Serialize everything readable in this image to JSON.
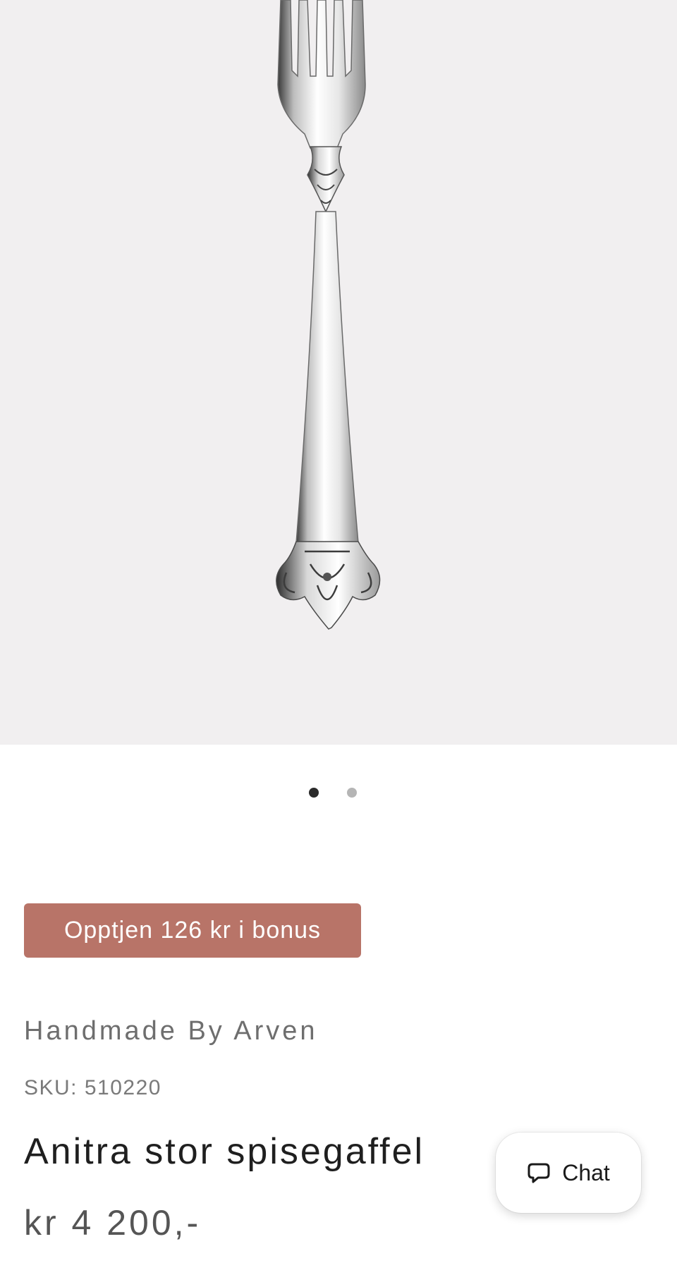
{
  "gallery": {
    "image_alt": "Anitra stor spisegaffel",
    "slide_count": 2,
    "active_slide": 1
  },
  "bonus_badge": {
    "label": "Opptjen 126 kr i bonus",
    "color": "#b87468"
  },
  "product": {
    "vendor": "Handmade By Arven",
    "sku": "SKU: 510220",
    "title": "Anitra stor spisegaffel",
    "price": "kr 4 200,-"
  },
  "chat_widget": {
    "label": "Chat",
    "icon": "chat-bubble-icon"
  }
}
